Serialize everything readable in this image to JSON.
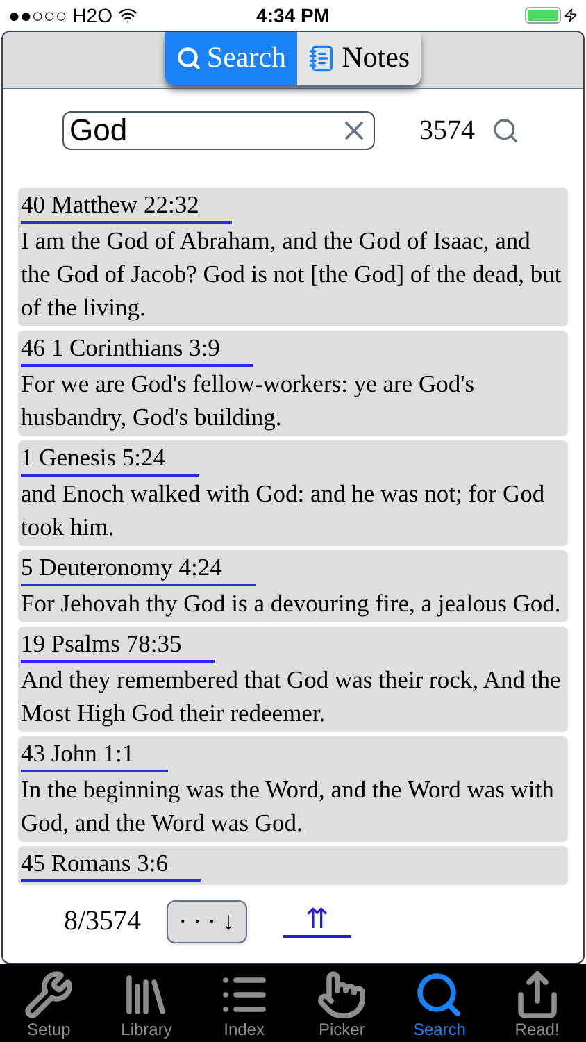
{
  "status_bar": {
    "carrier": "●●○○○ H2O",
    "time": "4:34 PM"
  },
  "segments": [
    {
      "label": "Search",
      "kind": "search",
      "selected": true
    },
    {
      "label": "Notes",
      "kind": "notes",
      "selected": false
    }
  ],
  "search": {
    "value": "God",
    "count": "3574"
  },
  "results": [
    {
      "reference": "40 Matthew 22:32",
      "text": "I am the God of Abraham, and the God of Isaac, and the God of Jacob? God is not [the God] of the dead, but of the living."
    },
    {
      "reference": "46 1 Corinthians 3:9",
      "text": "For we are God's fellow-workers: ye are God's husbandry, God's building."
    },
    {
      "reference": "1 Genesis 5:24",
      "text": "and Enoch walked with God: and he was not; for God took him."
    },
    {
      "reference": "5 Deuteronomy 4:24",
      "text": "For Jehovah thy God is a devouring fire, a jealous God."
    },
    {
      "reference": "19 Psalms 78:35",
      "text": "And they remembered that God was their rock, And the Most High God their redeemer."
    },
    {
      "reference": "43 John 1:1",
      "text": "In the beginning was the Word, and the Word was with God, and the Word was God."
    },
    {
      "reference": "45 Romans 3:6"
    }
  ],
  "pager": {
    "position": "8/3574",
    "more": "· · · ↓",
    "top": "⇈"
  },
  "tab_bar": [
    {
      "label": "Setup",
      "kind": "setup",
      "selected": false
    },
    {
      "label": "Library",
      "kind": "library",
      "selected": false
    },
    {
      "label": "Index",
      "kind": "index",
      "selected": false
    },
    {
      "label": "Picker",
      "kind": "picker",
      "selected": false
    },
    {
      "label": "Search",
      "kind": "search",
      "selected": true
    },
    {
      "label": "Read!",
      "kind": "read",
      "selected": false
    }
  ]
}
